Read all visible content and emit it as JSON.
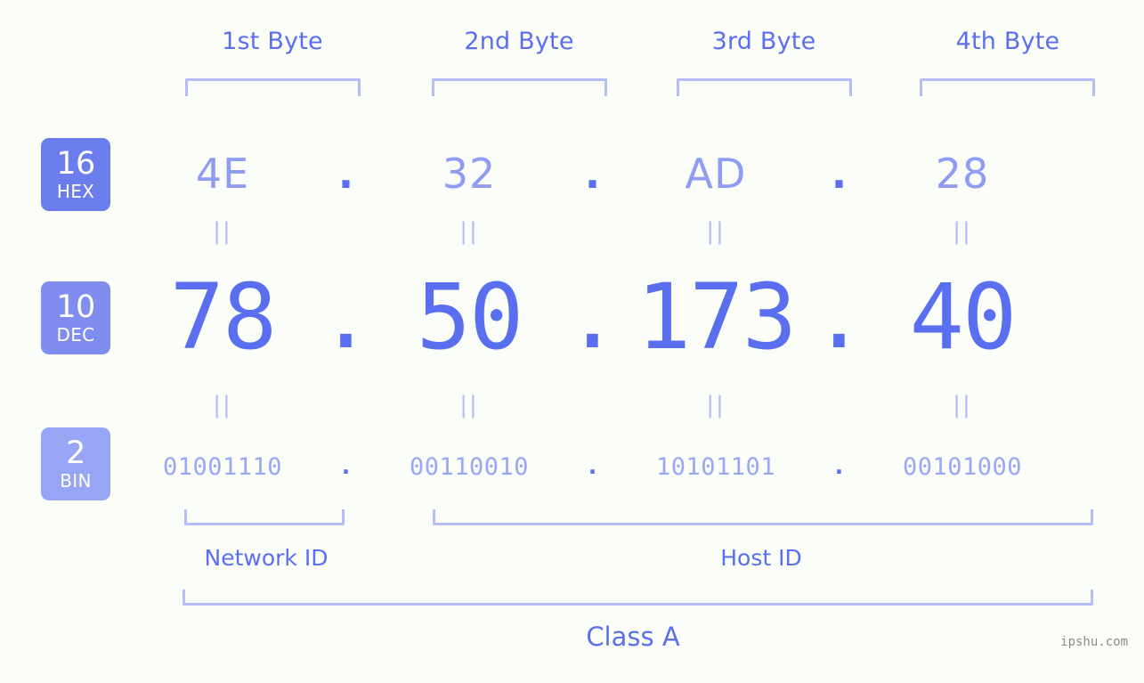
{
  "background": "#fbfdf8",
  "accent": "#5a6ff0",
  "accent_light": "#8e9cf2",
  "bracket_color": "#b4bdf7",
  "byte_headers": [
    {
      "label": "1st Byte"
    },
    {
      "label": "2nd Byte"
    },
    {
      "label": "3rd Byte"
    },
    {
      "label": "4th Byte"
    }
  ],
  "bases": [
    {
      "num": "16",
      "name": "HEX",
      "color": "#6b7ced"
    },
    {
      "num": "10",
      "name": "DEC",
      "color": "#7f8def"
    },
    {
      "num": "2",
      "name": "BIN",
      "color": "#97a5f5"
    }
  ],
  "separator": ".",
  "equals": "||",
  "rows": {
    "hex": {
      "values": [
        "4E",
        "32",
        "AD",
        "28"
      ]
    },
    "dec": {
      "values": [
        "78",
        "50",
        "173",
        "40"
      ]
    },
    "bin": {
      "values": [
        "01001110",
        "00110010",
        "10101101",
        "00101000"
      ]
    }
  },
  "sections": {
    "network_id": "Network ID",
    "host_id": "Host ID",
    "class": "Class A"
  },
  "watermark": "ipshu.com"
}
